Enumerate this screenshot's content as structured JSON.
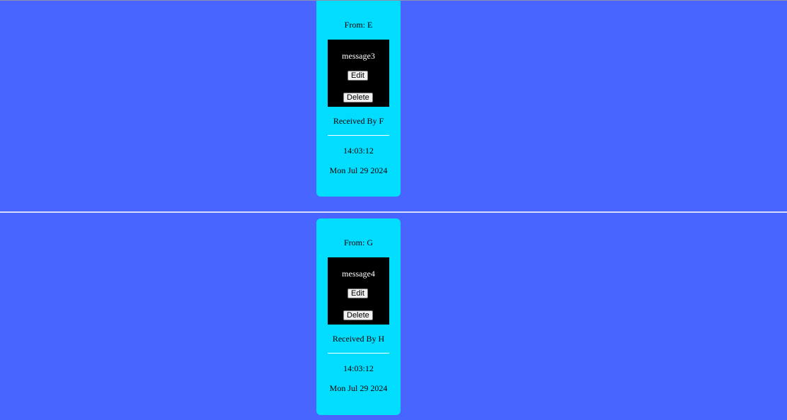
{
  "messages": [
    {
      "from": "From: E",
      "text": "message3",
      "edit_label": "Edit",
      "delete_label": "Delete",
      "received_by": "Received By F",
      "time": "14:03:12",
      "date": "Mon Jul 29 2024"
    },
    {
      "from": "From: G",
      "text": "message4",
      "edit_label": "Edit",
      "delete_label": "Delete",
      "received_by": "Received By H",
      "time": "14:03:12",
      "date": "Mon Jul 29 2024"
    }
  ],
  "colors": {
    "background": "#4965ff",
    "card": "#00ddff",
    "message_box": "#000000"
  }
}
